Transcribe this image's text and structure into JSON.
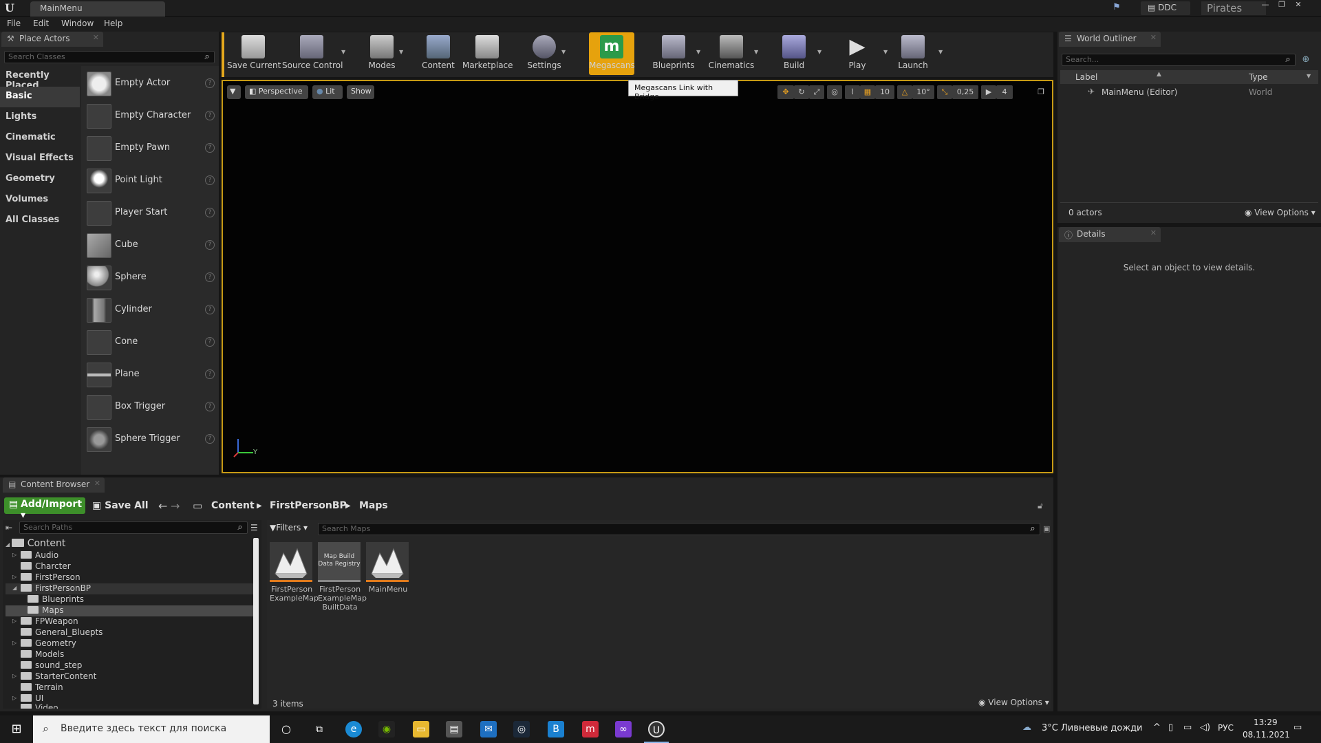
{
  "titlebar": {
    "tab_title": "MainMenu",
    "ddc_label": "DDC",
    "project_name": "Pirates"
  },
  "menu": [
    "File",
    "Edit",
    "Window",
    "Help"
  ],
  "place_actors": {
    "tab_label": "Place Actors",
    "search_placeholder": "Search Classes",
    "categories": [
      "Recently Placed",
      "Basic",
      "Lights",
      "Cinematic",
      "Visual Effects",
      "Geometry",
      "Volumes",
      "All Classes"
    ],
    "selected_category": "Basic",
    "actors": [
      "Empty Actor",
      "Empty Character",
      "Empty Pawn",
      "Point Light",
      "Player Start",
      "Cube",
      "Sphere",
      "Cylinder",
      "Cone",
      "Plane",
      "Box Trigger",
      "Sphere Trigger"
    ]
  },
  "toolbar": {
    "buttons": [
      "Save Current",
      "Source Control",
      "Modes",
      "Content",
      "Marketplace",
      "Settings",
      "Megascans",
      "Blueprints",
      "Cinematics",
      "Build",
      "Play",
      "Launch"
    ],
    "active": "Megascans",
    "tooltip": "Megascans Link with Bridge"
  },
  "viewport": {
    "perspective_label": "Perspective",
    "lit_label": "Lit",
    "show_label": "Show",
    "grid_snap": "10",
    "rotation_snap": "10°",
    "scale_snap": "0,25",
    "camera_speed": "4",
    "axis_y_label": "Y"
  },
  "world_outliner": {
    "tab_label": "World Outliner",
    "search_placeholder": "Search...",
    "col_label": "Label",
    "col_type": "Type",
    "row_label": "MainMenu (Editor)",
    "row_type": "World",
    "actor_count": "0 actors",
    "view_options": "View Options"
  },
  "details": {
    "tab_label": "Details",
    "empty_message": "Select an object to view details."
  },
  "content_browser": {
    "tab_label": "Content Browser",
    "add_import": "Add/Import",
    "save_all": "Save All",
    "breadcrumb": [
      "Content",
      "FirstPersonBP",
      "Maps"
    ],
    "search_paths_placeholder": "Search Paths",
    "filters_label": "Filters",
    "search_maps_placeholder": "Search Maps",
    "tree_root": "Content",
    "tree": [
      "Audio",
      "Charcter",
      "FirstPerson",
      "FirstPersonBP",
      "Blueprints",
      "Maps",
      "FPWeapon",
      "General_Bluepts",
      "Geometry",
      "Models",
      "sound_step",
      "StarterContent",
      "Terrain",
      "UI",
      "Video"
    ],
    "assets": [
      {
        "name_line1": "FirstPerson",
        "name_line2": "ExampleMap",
        "name_line3": "",
        "thumb_text1": "",
        "thumb_text2": ""
      },
      {
        "name_line1": "FirstPerson",
        "name_line2": "ExampleMap",
        "name_line3": "BuiltData",
        "thumb_text1": "Map Build",
        "thumb_text2": "Data Registry"
      },
      {
        "name_line1": "MainMenu",
        "name_line2": "",
        "name_line3": "",
        "thumb_text1": "",
        "thumb_text2": ""
      }
    ],
    "item_count": "3 items",
    "view_options": "View Options"
  },
  "taskbar": {
    "search_placeholder": "Введите здесь текст для поиска",
    "weather": "3°C  Ливневые дожди",
    "language": "РУС",
    "time": "13:29",
    "date": "08.11.2021"
  },
  "colors": {
    "accent_orange": "#e6a20d",
    "add_green": "#3d8f2a",
    "viewport_border": "#c79a14"
  }
}
